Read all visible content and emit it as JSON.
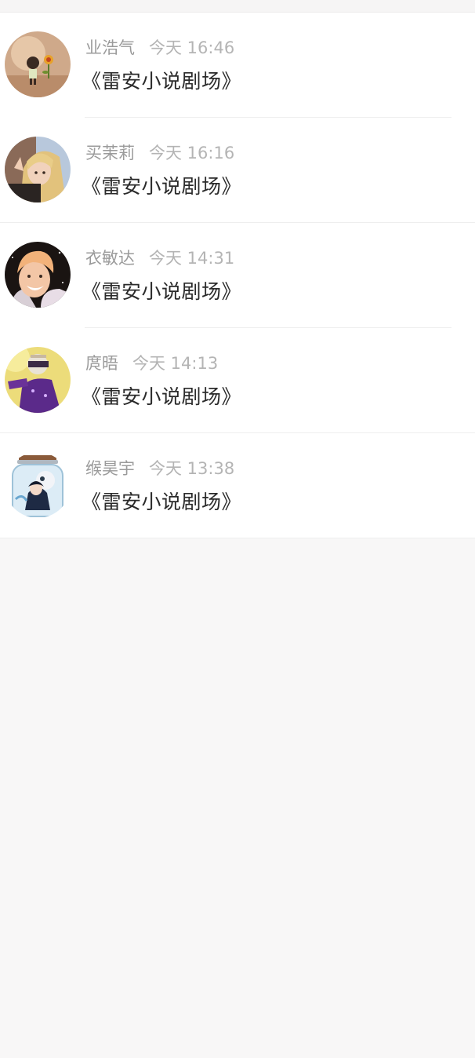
{
  "messages": [
    {
      "name": "业浩气",
      "time": "今天 16:46",
      "text": "《雷安小说剧场》",
      "avatar": "avatar-toy-figure"
    },
    {
      "name": "买茉莉",
      "time": "今天 16:16",
      "text": "《雷安小说剧场》",
      "avatar": "avatar-blonde-person"
    },
    {
      "name": "衣敏达",
      "time": "今天 14:31",
      "text": "《雷安小说剧场》",
      "avatar": "avatar-smiling-person"
    },
    {
      "name": "庹晤",
      "time": "今天 14:13",
      "text": "《雷安小说剧场》",
      "avatar": "avatar-purple-character"
    },
    {
      "name": "缑昊宇",
      "time": "今天 13:38",
      "text": "《雷安小说剧场》",
      "avatar": "avatar-jar-anime"
    }
  ],
  "colors": {
    "page_background": "#f8f7f7",
    "list_background": "#ffffff",
    "name_text": "#9b9b9b",
    "time_text": "#b4b4b4",
    "message_text": "#2a2a2a"
  }
}
